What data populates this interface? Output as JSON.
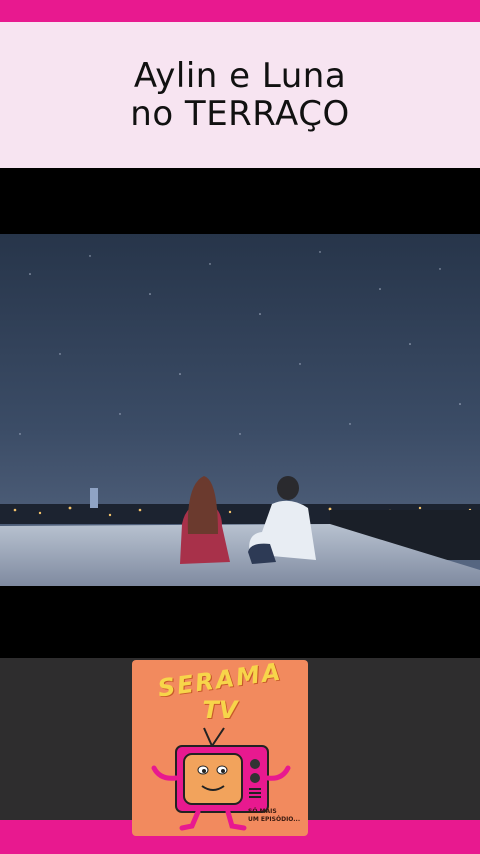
{
  "title": {
    "line1": "Aylin e Luna",
    "line2": "no TERRAÇO"
  },
  "logo": {
    "brand_line1": "SERAMA",
    "brand_line2": "TV",
    "tagline_line1": "SÓ MAIS",
    "tagline_line2": "UM EPISÓDIO..."
  },
  "colors": {
    "accent": "#e8198f",
    "title_panel": "#f7e4f1",
    "logo_bg": "#f28a5e",
    "logo_text": "#f7d54a",
    "tv_body": "#e8198f",
    "tv_screen": "#f2a35c",
    "bottom_panel": "#2e2d2e"
  }
}
